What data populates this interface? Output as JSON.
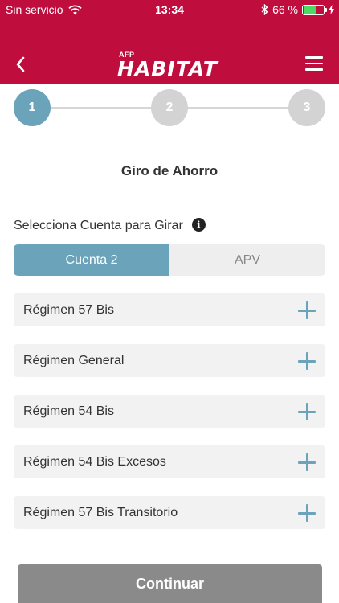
{
  "status_bar": {
    "carrier": "Sin servicio",
    "time": "13:34",
    "battery_percent": "66 %",
    "battery_level": 0.66,
    "icons": [
      "wifi-icon",
      "bluetooth-icon",
      "battery-icon",
      "charging-icon"
    ]
  },
  "nav": {
    "logo_small": "AFP",
    "logo_main": "HABITAT",
    "back_icon": "chevron-left-icon",
    "menu_icon": "hamburger-menu-icon"
  },
  "stepper": {
    "steps": [
      "1",
      "2",
      "3"
    ],
    "active_index": 0
  },
  "page": {
    "title": "Giro de Ahorro",
    "account_label": "Selecciona Cuenta para Girar"
  },
  "accounts": {
    "options": [
      "Cuenta 2",
      "APV"
    ],
    "selected": "Cuenta 2"
  },
  "regimes": [
    "Régimen 57 Bis",
    "Régimen General",
    "Régimen 54 Bis",
    "Régimen 54 Bis Excesos",
    "Régimen 57 Bis Transitorio"
  ],
  "actions": {
    "continue_label": "Continuar"
  },
  "colors": {
    "brand_red": "#bf0d3e",
    "accent_blue": "#6aa3ba",
    "button_gray": "#8a8a8a",
    "inactive_step": "#d3d3d3"
  }
}
